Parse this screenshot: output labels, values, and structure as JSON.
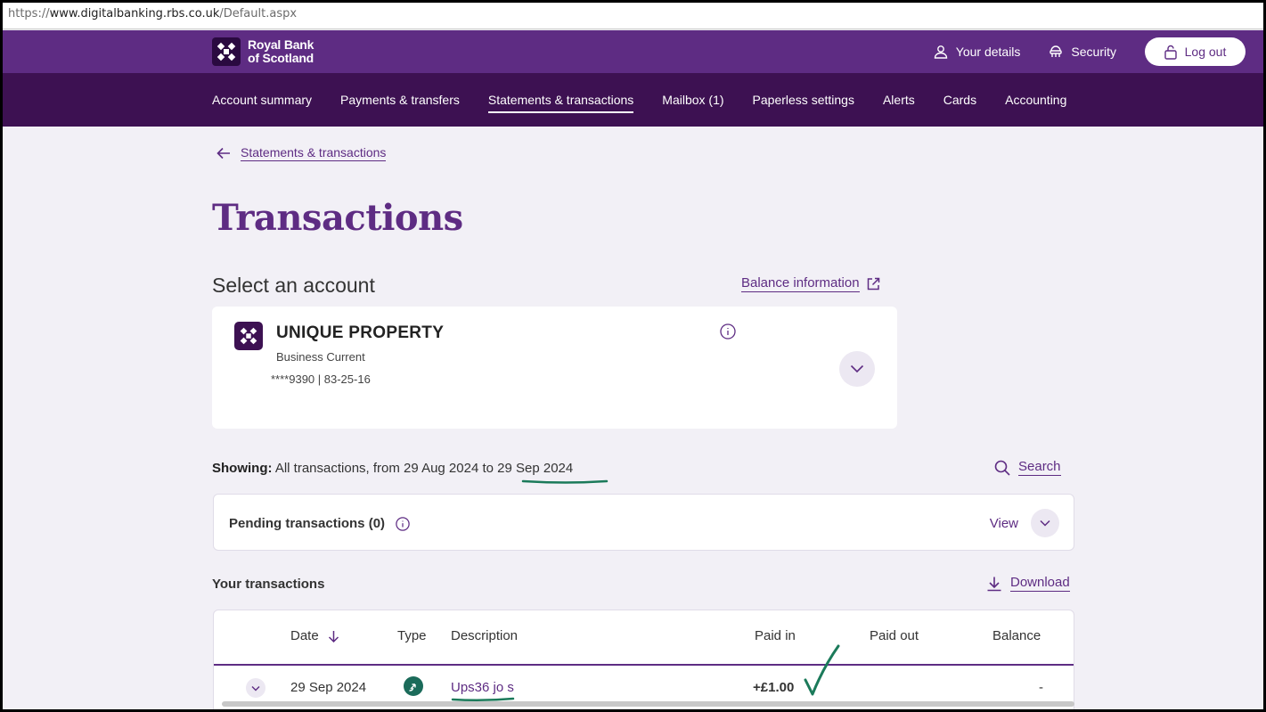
{
  "browser": {
    "url_scheme": "https://",
    "url_host": "www.digitalbanking.rbs.co.uk",
    "url_path": "/Default.aspx"
  },
  "header": {
    "logo_line1": "Royal Bank",
    "logo_line2": "of Scotland",
    "your_details": "Your details",
    "security": "Security",
    "logout": "Log out"
  },
  "nav": {
    "items": [
      "Account summary",
      "Payments & transfers",
      "Statements & transactions",
      "Mailbox (1)",
      "Paperless settings",
      "Alerts",
      "Cards",
      "Accounting"
    ],
    "active": "Statements & transactions"
  },
  "breadcrumb": {
    "back_label": "Statements & transactions"
  },
  "page": {
    "title": "Transactions",
    "select_account": "Select an account",
    "balance_information": "Balance information"
  },
  "account": {
    "name": "UNIQUE PROPERTY",
    "type": "Business Current",
    "number": "****9390 | 83-25-16"
  },
  "showing": {
    "label": "Showing:",
    "text_before": " All transactions, from 29 Aug 2024 to ",
    "date_to": "29 Sep 2024",
    "search": "Search"
  },
  "pending": {
    "label": "Pending transactions (0)",
    "view": "View"
  },
  "transactions": {
    "heading": "Your transactions",
    "download": "Download",
    "columns": {
      "date": "Date",
      "type": "Type",
      "description": "Description",
      "paid_in": "Paid in",
      "paid_out": "Paid out",
      "balance": "Balance"
    },
    "rows": [
      {
        "date": "29 Sep 2024",
        "description": "Ups36 jo s",
        "paid_in": "+£1.00",
        "paid_out": "",
        "balance": "-"
      }
    ]
  },
  "colors": {
    "brand": "#5e2c83",
    "nav": "#3d1152",
    "annotation": "#1b7a5a"
  }
}
